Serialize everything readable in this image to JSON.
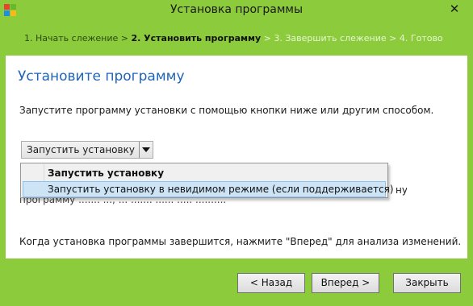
{
  "window": {
    "title": "Установка программы",
    "close_glyph": "✕"
  },
  "steps": {
    "step1": "1. Начать слежение",
    "sep1": " > ",
    "step2": "2. Установить программу",
    "sep2": " > ",
    "step3": "3. Завершить слежение",
    "sep3": " > ",
    "step4": "4. Готово"
  },
  "content": {
    "title": "Установите программу",
    "instruction": "Запустите программу установки с помощью кнопки ниже или другим способом.",
    "split_button_label": "Запустить установку",
    "hidden_line1_fragment": "ную",
    "hidden_line2_fragment": "программу ....... ..., ... ....... ......  ..... ..........",
    "note": "Когда установка программы завершится, нажмите \"Вперед\" для анализа изменений."
  },
  "menu": {
    "items": [
      {
        "label": "Запустить установку"
      },
      {
        "label": "Запустить установку в невидимом режиме (если поддерживается)"
      }
    ]
  },
  "footer": {
    "back": "< Назад",
    "next": "Вперед >",
    "close": "Закрыть"
  }
}
